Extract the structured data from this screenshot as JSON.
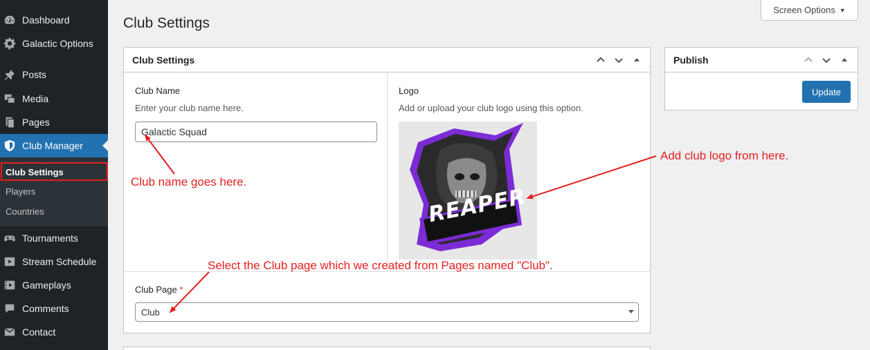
{
  "sidebar": {
    "items": [
      {
        "label": "Dashboard",
        "icon": "dashboard-icon"
      },
      {
        "label": "Galactic Options",
        "icon": "gear-icon"
      },
      {
        "label": "Posts",
        "icon": "pin-icon"
      },
      {
        "label": "Media",
        "icon": "media-icon"
      },
      {
        "label": "Pages",
        "icon": "pages-icon"
      },
      {
        "label": "Club Manager",
        "icon": "shield-icon"
      },
      {
        "label": "Tournaments",
        "icon": "gamepad-icon"
      },
      {
        "label": "Stream Schedule",
        "icon": "video-icon"
      },
      {
        "label": "Gameplays",
        "icon": "film-icon"
      },
      {
        "label": "Comments",
        "icon": "comment-icon"
      },
      {
        "label": "Contact",
        "icon": "mail-icon"
      }
    ],
    "submenu": [
      {
        "label": "Club Settings"
      },
      {
        "label": "Players"
      },
      {
        "label": "Countries"
      }
    ]
  },
  "header": {
    "title": "Club Settings",
    "screen_options": "Screen Options"
  },
  "settings_box": {
    "title": "Club Settings",
    "club_name_label": "Club Name",
    "club_name_desc": "Enter your club name here.",
    "club_name_value": "Galactic Squad",
    "logo_label": "Logo",
    "logo_desc": "Add or upload your club logo using this option.",
    "logo_text": "REAPER",
    "club_page_label": "Club Page",
    "required_mark": "*",
    "club_page_value": "Club"
  },
  "publish_box": {
    "title": "Publish",
    "update_label": "Update"
  },
  "annotations": {
    "club_name": "Club name goes here.",
    "logo": "Add club logo from here.",
    "club_page": "Select the Club page which we created from Pages named \"Club\"."
  },
  "colors": {
    "accent": "#2271b1",
    "annotation": "#e4201f",
    "sidebar_bg": "#1d2327"
  }
}
